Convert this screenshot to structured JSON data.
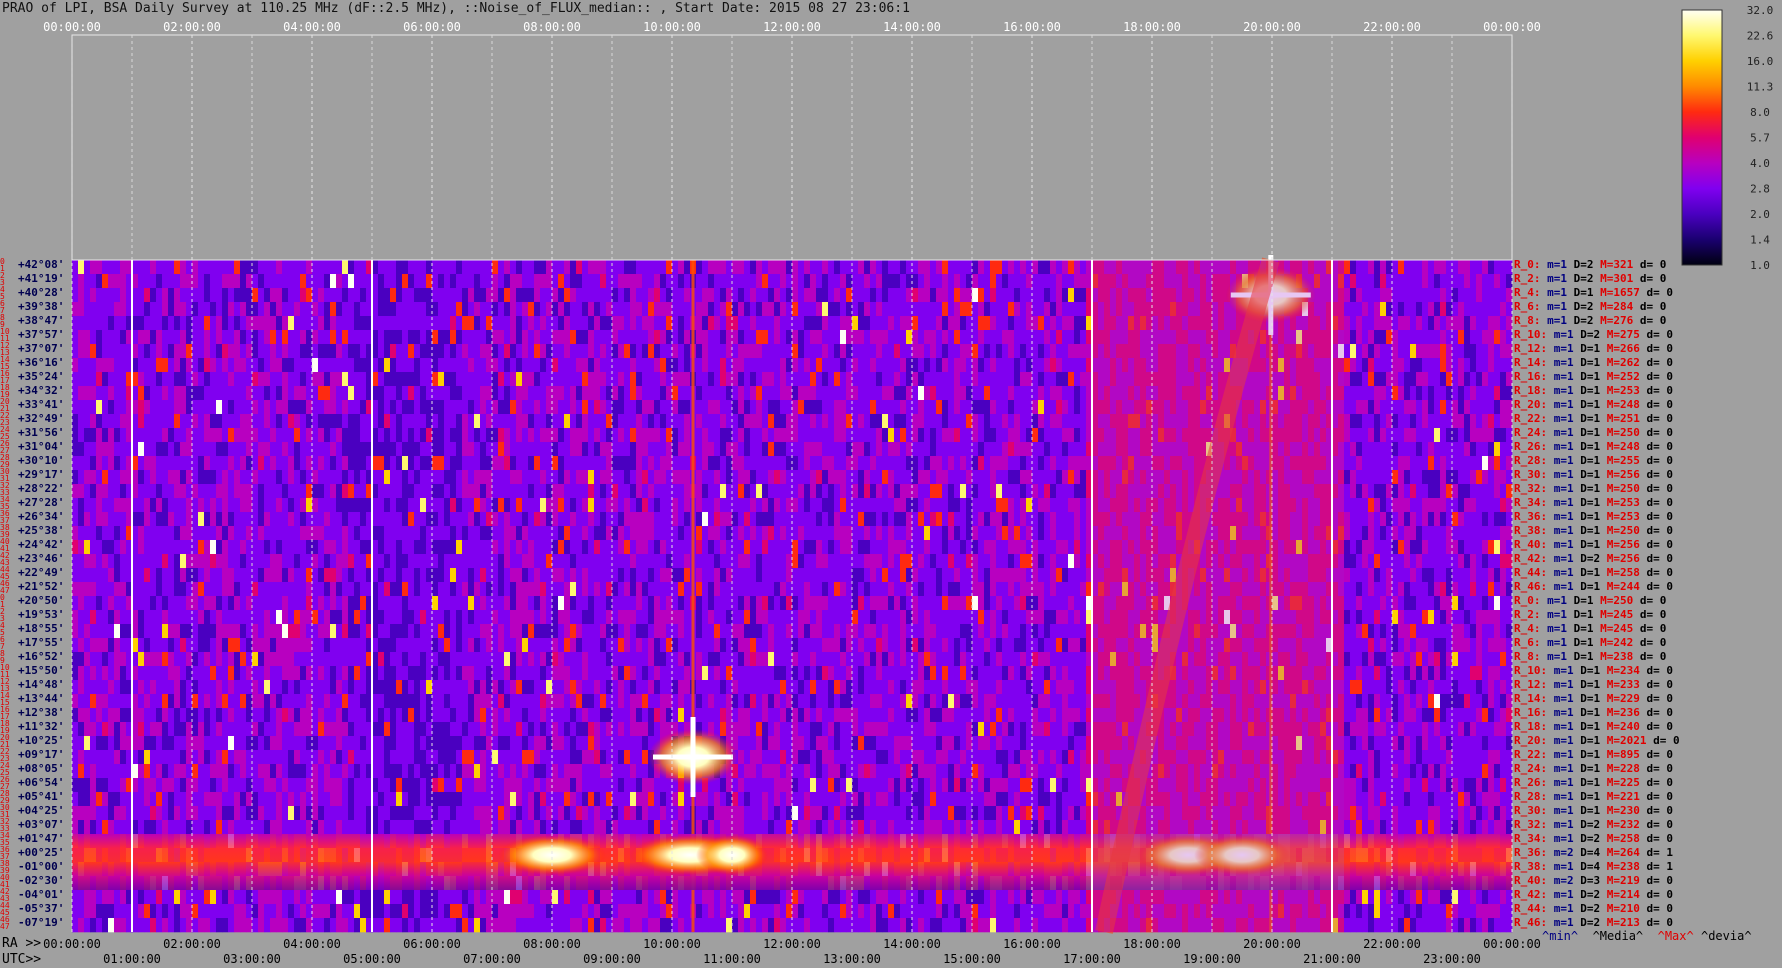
{
  "title": "PRAO of LPI, BSA Daily Survey at 110.25 MHz (dF::2.5 MHz), ::Noise_of_FLUX_median:: , Start Date: 2015 08 27 23:06:1",
  "chart_data": {
    "type": "heatmap",
    "top_time_labels": [
      "00:00:00",
      "02:00:00",
      "04:00:00",
      "06:00:00",
      "08:00:00",
      "10:00:00",
      "12:00:00",
      "14:00:00",
      "16:00:00",
      "18:00:00",
      "20:00:00",
      "22:00:00",
      "00:00:00"
    ],
    "ra_axis_prefix": "RA >>",
    "ra_labels": [
      "00:00:00",
      "02:00:00",
      "04:00:00",
      "06:00:00",
      "08:00:00",
      "10:00:00",
      "12:00:00",
      "14:00:00",
      "16:00:00",
      "18:00:00",
      "20:00:00",
      "22:00:00",
      "00:00:00"
    ],
    "utc_axis_prefix": "UTC>>",
    "utc_labels": [
      "01:00:00",
      "03:00:00",
      "05:00:00",
      "07:00:00",
      "09:00:00",
      "11:00:00",
      "13:00:00",
      "15:00:00",
      "17:00:00",
      "19:00:00",
      "21:00:00",
      "23:00:00"
    ],
    "declinations": [
      "+42°08'",
      "+41°19'",
      "+40°28'",
      "+39°38'",
      "+38°47'",
      "+37°57'",
      "+37°07'",
      "+36°16'",
      "+35°24'",
      "+34°32'",
      "+33°41'",
      "+32°49'",
      "+31°56'",
      "+31°04'",
      "+30°10'",
      "+29°17'",
      "+28°22'",
      "+27°28'",
      "+26°34'",
      "+25°38'",
      "+24°42'",
      "+23°46'",
      "+22°49'",
      "+21°52'",
      "+20°50'",
      "+19°53'",
      "+18°55'",
      "+17°55'",
      "+16°52'",
      "+15°50'",
      "+14°48'",
      "+13°44'",
      "+12°38'",
      "+11°32'",
      "+10°25'",
      "+09°17'",
      "+08°05'",
      "+06°54'",
      "+05°41'",
      "+04°25'",
      "+03°07'",
      "+01°47'",
      "+00°25'",
      "-01°00'",
      "-02°30'",
      "-04°01'",
      "-05°37'",
      "-07°19'"
    ],
    "row_numbers": [
      "0",
      "1",
      "2",
      "3",
      "4",
      "5",
      "6",
      "7",
      "8",
      "9",
      "10",
      "11",
      "12",
      "13",
      "14",
      "15",
      "16",
      "17",
      "18",
      "19",
      "20",
      "21",
      "22",
      "23",
      "24",
      "25",
      "26",
      "27",
      "28",
      "29",
      "30",
      "31",
      "32",
      "33",
      "34",
      "35",
      "36",
      "37",
      "38",
      "39",
      "40",
      "41",
      "42",
      "43",
      "44",
      "45",
      "46",
      "47",
      "0",
      "1",
      "2",
      "3",
      "4",
      "5",
      "6",
      "7",
      "8",
      "9",
      "10",
      "11",
      "12",
      "13",
      "14",
      "15",
      "16",
      "17",
      "18",
      "19",
      "20",
      "21",
      "22",
      "23",
      "24",
      "25",
      "26",
      "27",
      "28",
      "29",
      "30",
      "31",
      "32",
      "33",
      "34",
      "35",
      "36",
      "37",
      "38",
      "39",
      "40",
      "41",
      "42",
      "43",
      "44",
      "45",
      "46",
      "47"
    ],
    "row_stats": [
      {
        "label": "R_0:",
        "min": "m=1",
        "med": "D=2",
        "max": "M=321",
        "dev": "d= 0"
      },
      {
        "label": "R_2:",
        "min": "m=1",
        "med": "D=2",
        "max": "M=301",
        "dev": "d= 0"
      },
      {
        "label": "R_4:",
        "min": "m=1",
        "med": "D=1",
        "max": "M=1657",
        "dev": "d= 0"
      },
      {
        "label": "R_6:",
        "min": "m=1",
        "med": "D=2",
        "max": "M=284",
        "dev": "d= 0"
      },
      {
        "label": "R_8:",
        "min": "m=1",
        "med": "D=2",
        "max": "M=276",
        "dev": "d= 0"
      },
      {
        "label": "R_10:",
        "min": "m=1",
        "med": "D=2",
        "max": "M=275",
        "dev": "d= 0"
      },
      {
        "label": "R_12:",
        "min": "m=1",
        "med": "D=1",
        "max": "M=266",
        "dev": "d= 0"
      },
      {
        "label": "R_14:",
        "min": "m=1",
        "med": "D=1",
        "max": "M=262",
        "dev": "d= 0"
      },
      {
        "label": "R_16:",
        "min": "m=1",
        "med": "D=1",
        "max": "M=252",
        "dev": "d= 0"
      },
      {
        "label": "R_18:",
        "min": "m=1",
        "med": "D=1",
        "max": "M=253",
        "dev": "d= 0"
      },
      {
        "label": "R_20:",
        "min": "m=1",
        "med": "D=1",
        "max": "M=248",
        "dev": "d= 0"
      },
      {
        "label": "R_22:",
        "min": "m=1",
        "med": "D=1",
        "max": "M=251",
        "dev": "d= 0"
      },
      {
        "label": "R_24:",
        "min": "m=1",
        "med": "D=1",
        "max": "M=250",
        "dev": "d= 0"
      },
      {
        "label": "R_26:",
        "min": "m=1",
        "med": "D=1",
        "max": "M=248",
        "dev": "d= 0"
      },
      {
        "label": "R_28:",
        "min": "m=1",
        "med": "D=1",
        "max": "M=255",
        "dev": "d= 0"
      },
      {
        "label": "R_30:",
        "min": "m=1",
        "med": "D=1",
        "max": "M=256",
        "dev": "d= 0"
      },
      {
        "label": "R_32:",
        "min": "m=1",
        "med": "D=1",
        "max": "M=250",
        "dev": "d= 0"
      },
      {
        "label": "R_34:",
        "min": "m=1",
        "med": "D=1",
        "max": "M=253",
        "dev": "d= 0"
      },
      {
        "label": "R_36:",
        "min": "m=1",
        "med": "D=1",
        "max": "M=253",
        "dev": "d= 0"
      },
      {
        "label": "R_38:",
        "min": "m=1",
        "med": "D=1",
        "max": "M=250",
        "dev": "d= 0"
      },
      {
        "label": "R_40:",
        "min": "m=1",
        "med": "D=1",
        "max": "M=256",
        "dev": "d= 0"
      },
      {
        "label": "R_42:",
        "min": "m=1",
        "med": "D=2",
        "max": "M=256",
        "dev": "d= 0"
      },
      {
        "label": "R_44:",
        "min": "m=1",
        "med": "D=1",
        "max": "M=258",
        "dev": "d= 0"
      },
      {
        "label": "R_46:",
        "min": "m=1",
        "med": "D=1",
        "max": "M=244",
        "dev": "d= 0"
      },
      {
        "label": "R_0:",
        "min": "m=1",
        "med": "D=1",
        "max": "M=250",
        "dev": "d= 0"
      },
      {
        "label": "R_2:",
        "min": "m=1",
        "med": "D=1",
        "max": "M=245",
        "dev": "d= 0"
      },
      {
        "label": "R_4:",
        "min": "m=1",
        "med": "D=1",
        "max": "M=245",
        "dev": "d= 0"
      },
      {
        "label": "R_6:",
        "min": "m=1",
        "med": "D=1",
        "max": "M=242",
        "dev": "d= 0"
      },
      {
        "label": "R_8:",
        "min": "m=1",
        "med": "D=1",
        "max": "M=238",
        "dev": "d= 0"
      },
      {
        "label": "R_10:",
        "min": "m=1",
        "med": "D=1",
        "max": "M=234",
        "dev": "d= 0"
      },
      {
        "label": "R_12:",
        "min": "m=1",
        "med": "D=1",
        "max": "M=233",
        "dev": "d= 0"
      },
      {
        "label": "R_14:",
        "min": "m=1",
        "med": "D=1",
        "max": "M=229",
        "dev": "d= 0"
      },
      {
        "label": "R_16:",
        "min": "m=1",
        "med": "D=1",
        "max": "M=236",
        "dev": "d= 0"
      },
      {
        "label": "R_18:",
        "min": "m=1",
        "med": "D=1",
        "max": "M=240",
        "dev": "d= 0"
      },
      {
        "label": "R_20:",
        "min": "m=1",
        "med": "D=1",
        "max": "M=2021",
        "dev": "d= 0"
      },
      {
        "label": "R_22:",
        "min": "m=1",
        "med": "D=1",
        "max": "M=895",
        "dev": "d= 0"
      },
      {
        "label": "R_24:",
        "min": "m=1",
        "med": "D=1",
        "max": "M=228",
        "dev": "d= 0"
      },
      {
        "label": "R_26:",
        "min": "m=1",
        "med": "D=1",
        "max": "M=225",
        "dev": "d= 0"
      },
      {
        "label": "R_28:",
        "min": "m=1",
        "med": "D=1",
        "max": "M=221",
        "dev": "d= 0"
      },
      {
        "label": "R_30:",
        "min": "m=1",
        "med": "D=1",
        "max": "M=230",
        "dev": "d= 0"
      },
      {
        "label": "R_32:",
        "min": "m=1",
        "med": "D=2",
        "max": "M=232",
        "dev": "d= 0"
      },
      {
        "label": "R_34:",
        "min": "m=1",
        "med": "D=2",
        "max": "M=258",
        "dev": "d= 0"
      },
      {
        "label": "R_36:",
        "min": "m=2",
        "med": "D=4",
        "max": "M=264",
        "dev": "d= 1"
      },
      {
        "label": "R_38:",
        "min": "m=1",
        "med": "D=4",
        "max": "M=238",
        "dev": "d= 1"
      },
      {
        "label": "R_40:",
        "min": "m=2",
        "med": "D=3",
        "max": "M=219",
        "dev": "d= 0"
      },
      {
        "label": "R_42:",
        "min": "m=1",
        "med": "D=2",
        "max": "M=214",
        "dev": "d= 0"
      },
      {
        "label": "R_44:",
        "min": "m=1",
        "med": "D=2",
        "max": "M=210",
        "dev": "d= 0"
      },
      {
        "label": "R_46:",
        "min": "m=1",
        "med": "D=2",
        "max": "M=213",
        "dev": "d= 0"
      }
    ],
    "legend_keys": {
      "min": "^min^",
      "median": "^Media^",
      "max": "^Max^",
      "dev": "^devia^"
    },
    "colorbar": {
      "ticks": [
        "32.0",
        "22.6",
        "16.0",
        "11.3",
        "8.0",
        "5.7",
        "4.0",
        "2.8",
        "2.0",
        "1.4",
        "1.0"
      ],
      "scale": "log",
      "colors": [
        "#fffff4",
        "#fff870",
        "#ffd000",
        "#ff8a00",
        "#ff2a10",
        "#e00070",
        "#b800c0",
        "#8000f0",
        "#4a00c0",
        "#1a0070",
        "#000010"
      ]
    },
    "features": [
      {
        "name": "bright-source-1",
        "ra_hours": 10.35,
        "dec_index": 35
      },
      {
        "name": "bright-source-2",
        "ra_hours": 19.98,
        "dec_index": 2
      },
      {
        "name": "galactic-plane-band",
        "dec_index_start": 41,
        "dec_index_end": 44
      },
      {
        "name": "galactic-arc",
        "ra_hours_start": 17.0,
        "ra_hours_end": 20.8
      }
    ]
  }
}
